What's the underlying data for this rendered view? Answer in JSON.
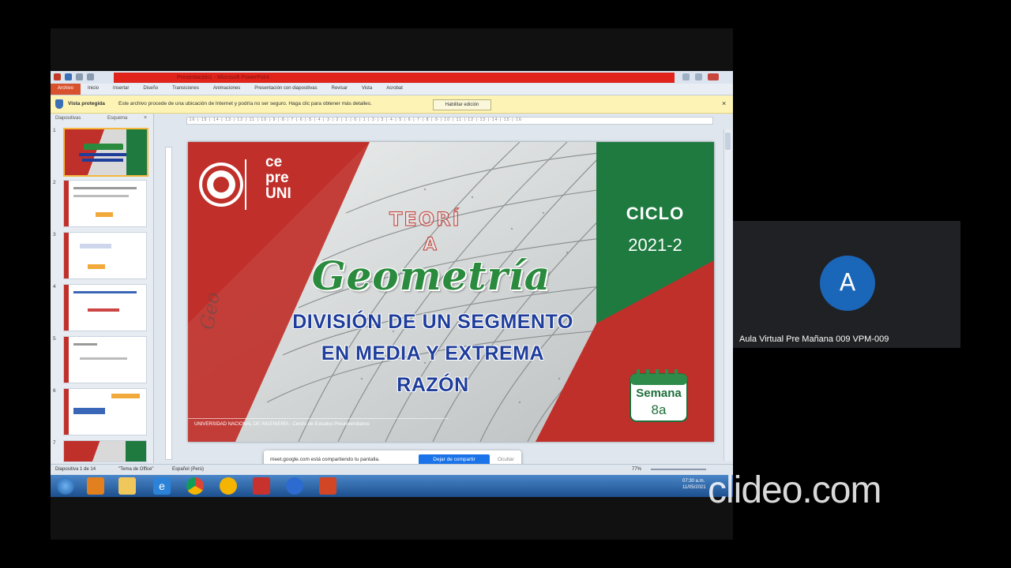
{
  "window": {
    "title_text": "Presentación1 - Microsoft PowerPoint",
    "file_tab": "Archivo",
    "tabs": [
      "Inicio",
      "Insertar",
      "Diseño",
      "Transiciones",
      "Animaciones",
      "Presentación con diapositivas",
      "Revisar",
      "Vista",
      "Acrobat"
    ]
  },
  "protected_view": {
    "label": "Vista protegida",
    "message": "Este archivo procede de una ubicación de Internet y podría no ser seguro. Haga clic para obtener más detalles.",
    "button": "Habilitar edición",
    "close": "×"
  },
  "left_panel": {
    "tabs": [
      "Diapositivas",
      "Esquema"
    ],
    "slide_numbers": [
      "1",
      "2",
      "3",
      "4",
      "5",
      "6",
      "7"
    ]
  },
  "ruler_text": "·16·|·15·|·14·|·13·|·12·|·11·|·10·|·9·|·8·|·7·|·6·|·5·|·4·|·3·|·2·|·1·|·0·|·1·|·2·|·3·|·4·|·5·|·6·|·7·|·8·|·9·|·10·|·11·|·12·|·13·|·14·|·15·|·16·",
  "slide": {
    "cepre_lines": [
      "ce",
      "pre",
      "UNI"
    ],
    "teoria": "TEORÍ",
    "teoria_a": "A",
    "title": "Geometría",
    "subtitle_lines": [
      "DIVISIÓN DE UN SEGMENTO",
      "EN MEDIA Y EXTREMA",
      "RAZÓN"
    ],
    "ciclo_label": "CICLO",
    "ciclo_year": "2021-2",
    "semana_label": "Semana",
    "semana_num": "8a",
    "footer": "UNIVERSIDAD NACIONAL DE INGENIERÍA - Centro de Estudios Preuniversitarios",
    "vertical_text": "Geo"
  },
  "colors": {
    "red": "#c0302a",
    "green": "#1f7a40",
    "blue_text": "#1f3e9c",
    "geom_green": "#2a8a3d"
  },
  "status_bar": {
    "slide_pos": "Diapositiva 1 de 14",
    "theme": "\"Tema de Office\"",
    "lang": "Español (Perú)",
    "zoom": "77%"
  },
  "share_banner": {
    "message": "meet.google.com está compartiendo tu pantalla.",
    "stop_button": "Dejar de compartir",
    "hide": "Ocultar"
  },
  "taskbar": {
    "clock_time": "07:30 a.m.",
    "clock_date": "11/05/2021"
  },
  "participant": {
    "initial": "A",
    "name": "Aula Virtual Pre Mañana 009 VPM-009"
  },
  "watermark": "clideo.com"
}
